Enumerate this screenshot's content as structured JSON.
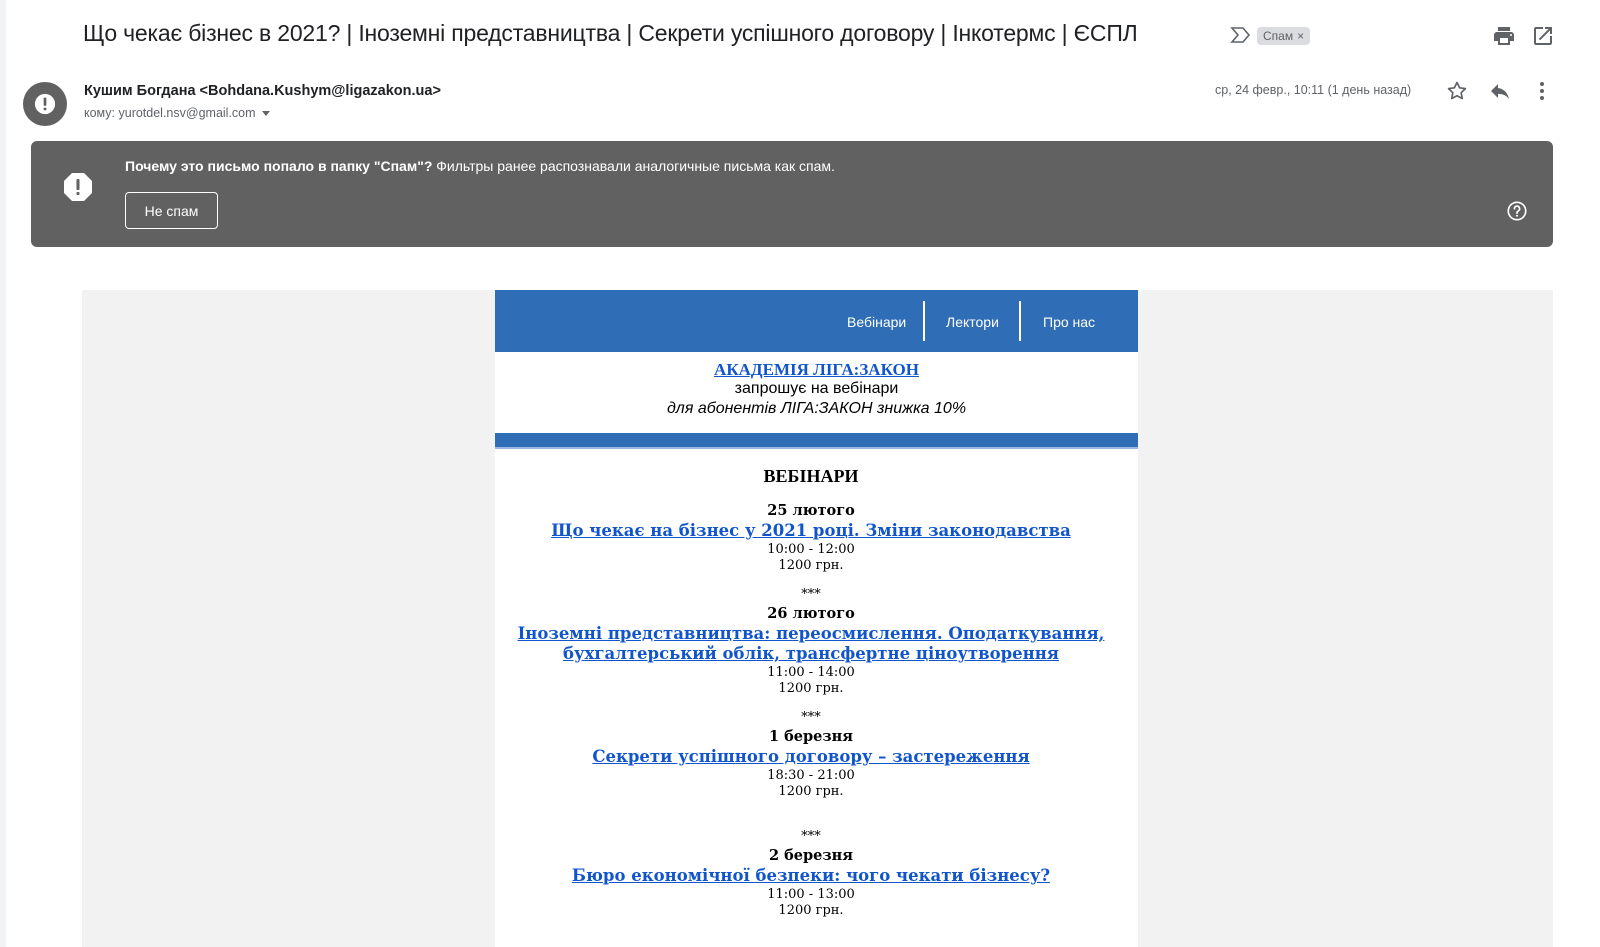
{
  "header": {
    "subject": "Що чекає бізнес в 2021? | Іноземні представництва | Секрети успішного договору | Інкотермс | ЄСПЛ",
    "label_chip": "Спам",
    "label_chip_close": "×",
    "icons": [
      "importance-marker-icon",
      "print-icon",
      "open-in-new-window-icon"
    ]
  },
  "message": {
    "sender": "Кушим Богдана <Bohdana.Kushym@ligazakon.ua>",
    "recipient": "кому: yurotdel.nsv@gmail.com",
    "date": "ср, 24 февр., 10:11 (1 день назад)",
    "icons": [
      "star-icon",
      "reply-icon",
      "more-vert-icon"
    ]
  },
  "spam_banner": {
    "question": "Почему это письмо попало в папку \"Спам\"?",
    "explanation": " Фильтры ранее распознавали аналогичные письма как спам.",
    "not_spam_label": "Не спам",
    "colors": {
      "banner_bg": "#616161"
    }
  },
  "email": {
    "nav": [
      "Вебінари",
      "Лектори",
      "Про нас"
    ],
    "academy_link": "АКАДЕМІЯ ЛІГА:ЗАКОН",
    "invite_text": "запрошує на вебінари",
    "discount_text": "для абонентів ЛІГА:ЗАКОН знижка 10%",
    "section_title": "ВЕБІНАРИ",
    "separator": "***",
    "events": [
      {
        "date": "25 лютого",
        "title_lines": [
          "Що чекає на бізнес у 2021 році. Зміни законодавства"
        ],
        "time": "10:00 - 12:00",
        "price": "1200 грн."
      },
      {
        "date": "26 лютого",
        "title_lines": [
          "Іноземні представництва: переосмислення. Оподаткування,",
          "бухгалтерський облік, трансфертне ціноутворення"
        ],
        "time": "11:00 - 14:00",
        "price": "1200 грн."
      },
      {
        "date": "1 березня",
        "title_lines": [
          "Секрети успішного договору – застереження"
        ],
        "time": "18:30 - 21:00",
        "price": "1200 грн."
      },
      {
        "date": "2 березня",
        "title_lines": [
          "Бюро економічної безпеки: чого чекати бізнесу?"
        ],
        "time": "11:00 - 13:00",
        "price": "1200 грн."
      }
    ],
    "colors": {
      "brand_blue": "#2f6db6",
      "link": "#1155cc"
    }
  }
}
